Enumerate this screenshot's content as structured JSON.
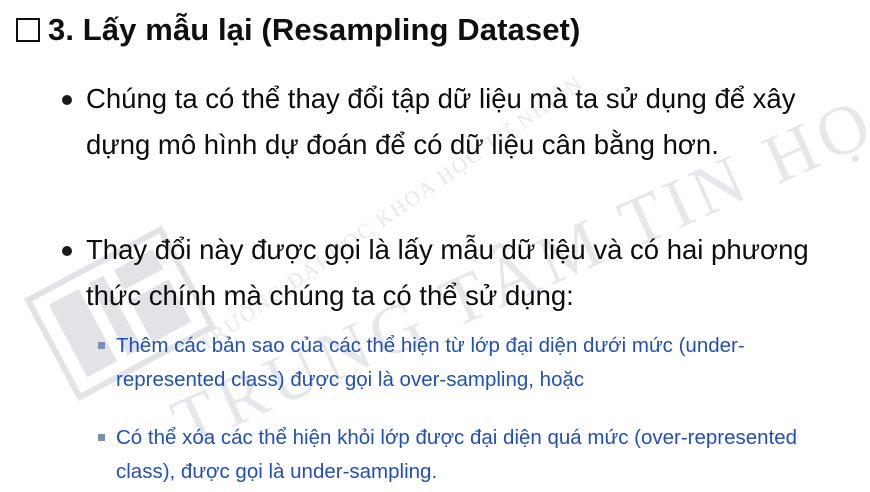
{
  "slide": {
    "title": "3. Lấy mẫu lại (Resampling Dataset)",
    "title_icon": "checkbox-square-icon",
    "bullets": [
      {
        "text": "Chúng ta có thể thay đổi tập dữ liệu mà ta sử dụng để xây dựng mô hình dự đoán để có dữ liệu cân bằng hơn."
      },
      {
        "text": "Thay đổi này được gọi là lấy mẫu dữ liệu và có hai phương thức chính mà chúng ta có thể sử dụng:",
        "sub_bullets": [
          {
            "text": "Thêm các bản sao của các thể hiện từ lớp đại diện dưới mức (under-represented class) được gọi là over-sampling, hoặc"
          },
          {
            "text": "Có thể xóa các thể hiện khỏi lớp được đại diện quá mức (over-represented class), được gọi là under-sampling."
          }
        ]
      }
    ]
  },
  "watermark": {
    "line_small": "TRƯỜNG ĐẠI HỌC KHOA HỌC TỰ NHIÊN",
    "line_large": "TRUNG TÂM TIN HỌC",
    "color": "#c9cdd8",
    "logo_icon": "university-logo-icon"
  },
  "colors": {
    "title": "#0f0f0f",
    "body_text": "#0d0d0d",
    "sub_text": "#1f4fbf",
    "sub_bullet_marker": "#7c8fb1"
  }
}
